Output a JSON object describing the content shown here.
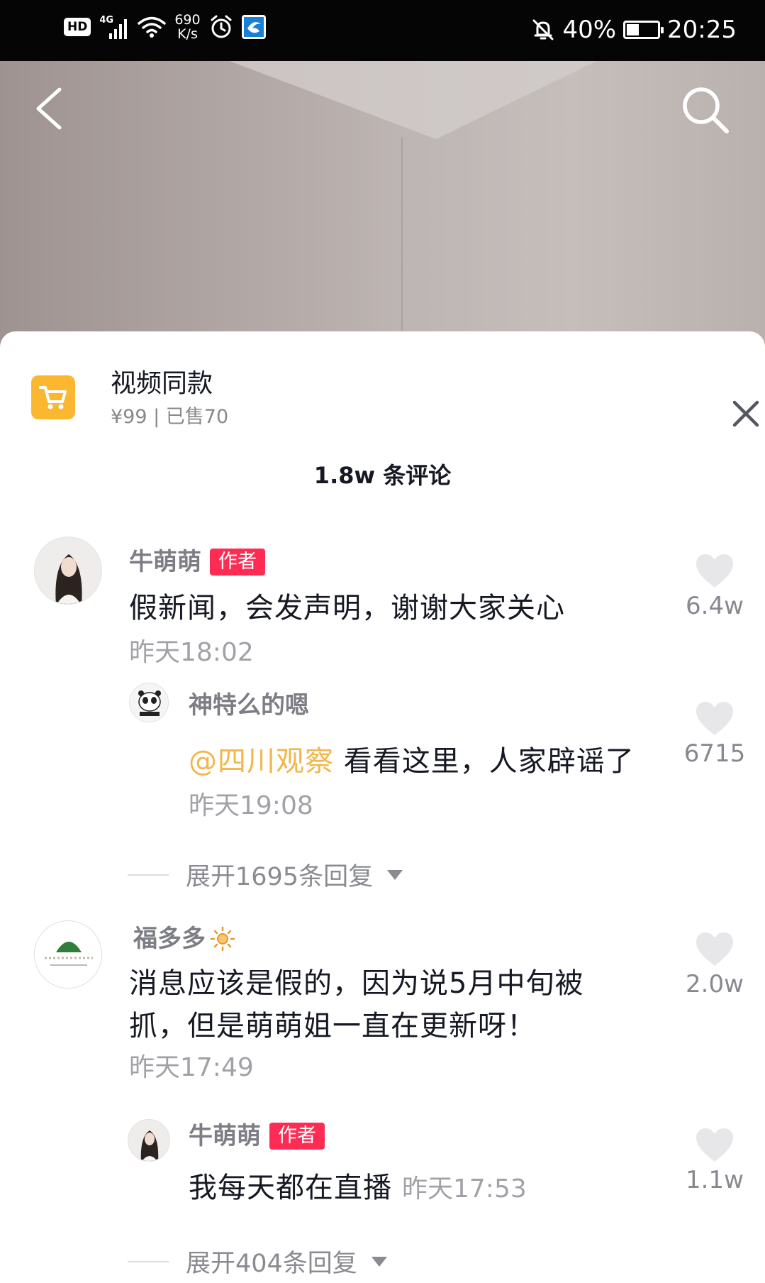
{
  "status_bar": {
    "hd": "HD",
    "network": "4G",
    "net_speed_value": "690",
    "net_speed_unit": "K/s",
    "battery": "40%",
    "battery_level": 0.4,
    "time": "20:25",
    "icons": [
      "hd-icon",
      "signal-icon",
      "wifi-icon",
      "alarm-icon",
      "app-notification-icon",
      "mute-icon",
      "battery-charging-icon"
    ]
  },
  "nav": {
    "back_icon": "chevron-left-icon",
    "search_icon": "search-icon"
  },
  "product": {
    "title": "视频同款",
    "subtitle": "¥99 | 已售70",
    "icon": "shopping-cart-icon",
    "accent": "#FBB730"
  },
  "comments_header": {
    "count_label": "1.8w 条评论"
  },
  "comments": [
    {
      "user": "牛萌萌",
      "tag": "作者",
      "text": "假新闻，会发声明，谢谢大家关心",
      "time": "昨天18:02",
      "likes": "6.4w",
      "reply": {
        "user": "神特么的嗯",
        "mention": "@四川观察",
        "text": " 看看这里，人家辟谣了",
        "time": "昨天19:08",
        "likes": "6715"
      },
      "expand": "展开1695条回复"
    },
    {
      "user": "福多多",
      "user_prefix": "",
      "text_line1": "消息应该是假的，因为说5月中旬被",
      "text_line2": "抓，但是萌萌姐一直在更新呀！",
      "time": "昨天17:49",
      "likes": "2.0w",
      "reply": {
        "user": "牛萌萌",
        "tag": "作者",
        "text": "我每天都在直播",
        "time": "昨天17:53",
        "likes": "1.1w"
      },
      "expand": "展开404条回复"
    }
  ],
  "colors": {
    "author_tag": "#FE2C55",
    "mention": "#F2B64A",
    "muted": "#A1A2A8"
  }
}
